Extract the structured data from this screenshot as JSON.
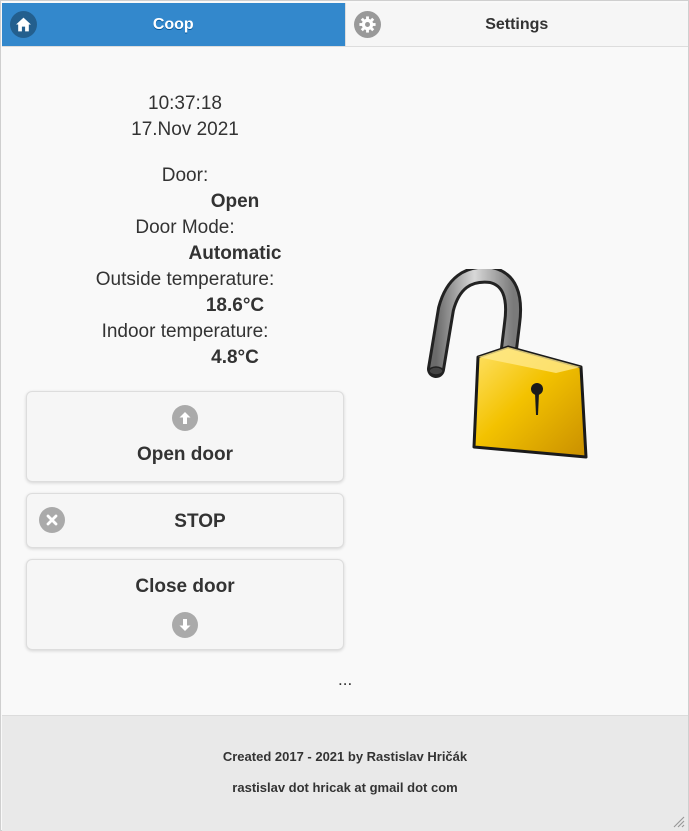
{
  "tabs": {
    "coop": {
      "label": "Coop",
      "icon": "home-icon",
      "active": true
    },
    "settings": {
      "label": "Settings",
      "icon": "gear-icon",
      "active": false
    }
  },
  "clock": {
    "time": "10:37:18",
    "date": "17.Nov 2021"
  },
  "status": {
    "door_label": "Door:",
    "door_value": "Open",
    "door_mode_label": "Door Mode:",
    "door_mode_value": "Automatic",
    "outside_temp_label": "Outside temperature:",
    "outside_temp_value": "18.6°C",
    "indoor_temp_label": "Indoor temperature:",
    "indoor_temp_value": "4.8°C"
  },
  "buttons": {
    "open": {
      "label": "Open door",
      "icon": "arrow-up-icon"
    },
    "stop": {
      "label": "STOP",
      "icon": "close-icon"
    },
    "close": {
      "label": "Close door",
      "icon": "arrow-down-icon"
    }
  },
  "lock_state_icon": "open-padlock-icon",
  "ellipsis": "...",
  "footer": {
    "credit": "Created 2017 - 2021 by Rastislav Hričák",
    "contact": "rastislav dot hricak at gmail dot com"
  },
  "colors": {
    "tab_active": "#3388cc",
    "lock_gold": "#f3c200"
  }
}
